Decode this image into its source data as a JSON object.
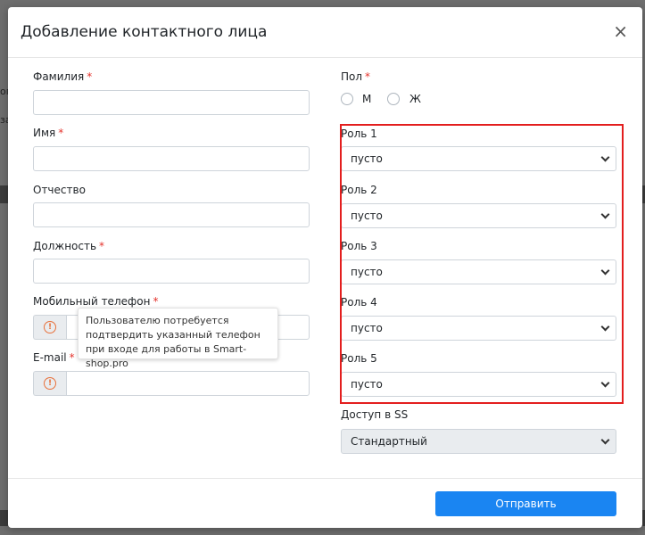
{
  "modal": {
    "title": "Добавление контактного лица",
    "close_glyph": "×"
  },
  "fields": {
    "lastname_label": "Фамилия",
    "firstname_label": "Имя",
    "patronymic_label": "Отчество",
    "position_label": "Должность",
    "mobile_label": "Мобильный телефон",
    "email_label": "E-mail",
    "required_mark": "*"
  },
  "gender": {
    "label": "Пол",
    "options": [
      "М",
      "Ж"
    ]
  },
  "roles": [
    {
      "label": "Роль 1",
      "value": "пусто"
    },
    {
      "label": "Роль 2",
      "value": "пусто"
    },
    {
      "label": "Роль 3",
      "value": "пусто"
    },
    {
      "label": "Роль 4",
      "value": "пусто"
    },
    {
      "label": "Роль 5",
      "value": "пусто"
    }
  ],
  "access": {
    "label": "Доступ в SS",
    "value": "Стандартный"
  },
  "tooltip": {
    "text": "Пользователю потребуется подтвердить указанный телефон при входе для работы в Smart-shop.pro"
  },
  "icons": {
    "warning": "warning-circle-icon",
    "close": "close-icon",
    "chevron": "chevron-down-icon"
  },
  "colors": {
    "primary": "#1a85f2",
    "required": "#e4322b",
    "highlight": "#e31e1e",
    "warning": "#e8703a"
  },
  "actions": {
    "submit_label": "Отправить"
  }
}
